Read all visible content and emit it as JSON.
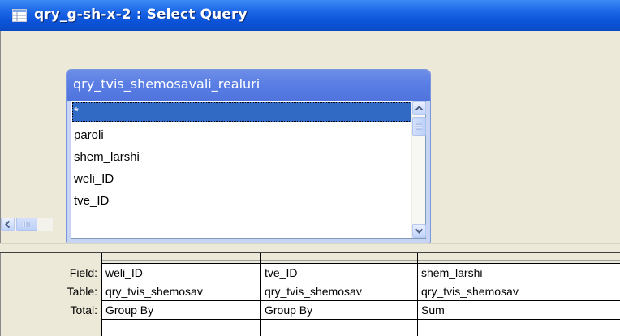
{
  "window": {
    "title": "qry_g-sh-x-2 : Select Query",
    "icon": "query-icon"
  },
  "field_list": {
    "title": "qry_tvis_shemosavali_realuri",
    "items": [
      "*",
      "paroli",
      "shem_larshi",
      "weli_ID",
      "tve_ID"
    ],
    "selected_index": 0
  },
  "grid": {
    "row_labels": [
      "Field:",
      "Table:",
      "Total:"
    ],
    "columns": [
      {
        "field": "weli_ID",
        "table": "qry_tvis_shemosav",
        "total": "Group By"
      },
      {
        "field": "tve_ID",
        "table": "qry_tvis_shemosav",
        "total": "Group By"
      },
      {
        "field": "shem_larshi",
        "table": "qry_tvis_shemosav",
        "total": "Sum"
      },
      {
        "field": "",
        "table": "",
        "total": ""
      }
    ]
  },
  "colors": {
    "titlebar": "#0b53d8",
    "field_list_caption": "#5a7ee4",
    "selection": "#316ac5",
    "pane_background": "#ece9d8"
  }
}
